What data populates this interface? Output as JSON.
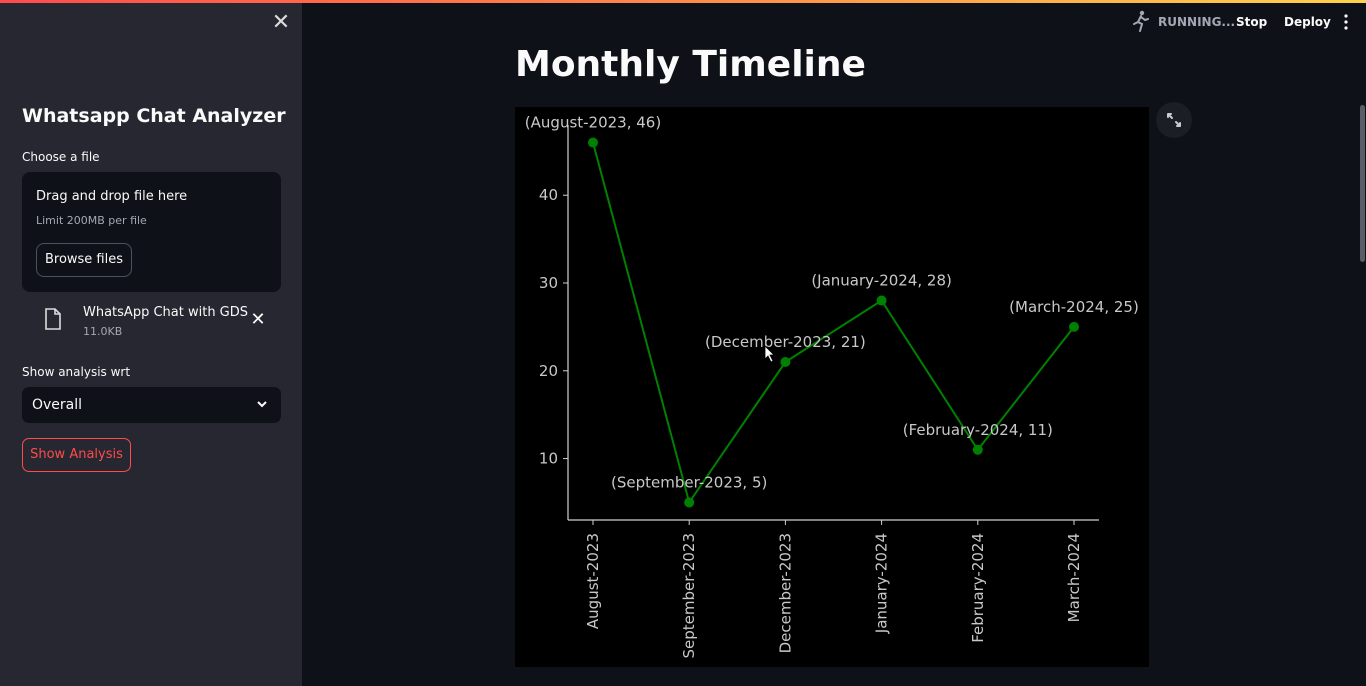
{
  "sidebar": {
    "title": "Whatsapp Chat Analyzer",
    "file_label": "Choose a file",
    "dropzone_title": "Drag and drop file here",
    "dropzone_limit": "Limit 200MB per file",
    "browse_label": "Browse files",
    "uploaded_file_name": "WhatsApp Chat with GDS...",
    "uploaded_file_size": "11.0KB",
    "analysis_label": "Show analysis wrt",
    "analysis_selected": "Overall",
    "show_analysis_label": "Show Analysis"
  },
  "header": {
    "status": "RUNNING...",
    "stop_label": "Stop",
    "deploy_label": "Deploy"
  },
  "main": {
    "title": "Monthly Timeline"
  },
  "colors": {
    "line": "#008000",
    "accent": "#ff4b4b"
  },
  "chart_data": {
    "type": "line",
    "title": "",
    "xlabel": "",
    "ylabel": "",
    "categories": [
      "August-2023",
      "September-2023",
      "December-2023",
      "January-2024",
      "February-2024",
      "March-2024"
    ],
    "values": [
      46,
      5,
      21,
      28,
      11,
      25
    ],
    "annotations": [
      "(August-2023, 46)",
      "(September-2023, 5)",
      "(December-2023, 21)",
      "(January-2024, 28)",
      "(February-2024, 11)",
      "(March-2024, 25)"
    ],
    "y_ticks": [
      10,
      20,
      30,
      40
    ],
    "ylim": [
      3,
      48
    ],
    "grid": false,
    "legend": "none"
  }
}
